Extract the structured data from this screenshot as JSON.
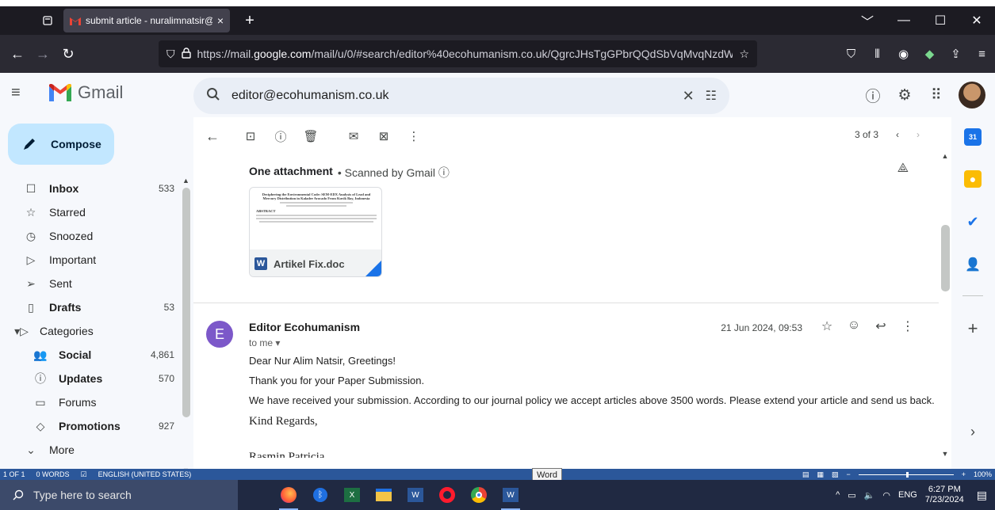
{
  "browser": {
    "tab_title": "submit article - nuralimnatsir@",
    "tab_close": "×",
    "new_tab": "+",
    "url_prefix": "https://mail.",
    "url_domain": "google.com",
    "url_path": "/mail/u/0/#search/editor%40ecohumanism.co.uk/QgrcJHsTgGPbrQQdSbVqMvqNzdWBFrQj",
    "window_controls": [
      "﹀",
      "—",
      "☐",
      "✕"
    ]
  },
  "gmail": {
    "logo_text": "Gmail",
    "search_value": "editor@ecohumanism.co.uk",
    "compose_label": "Compose"
  },
  "sidebar": {
    "items": [
      {
        "icon": "☐",
        "label": "Inbox",
        "count": "533",
        "bold": true,
        "key": "inbox"
      },
      {
        "icon": "☆",
        "label": "Starred",
        "count": "",
        "bold": false,
        "key": "starred"
      },
      {
        "icon": "◷",
        "label": "Snoozed",
        "count": "",
        "bold": false,
        "key": "snoozed"
      },
      {
        "icon": "▷",
        "label": "Important",
        "count": "",
        "bold": false,
        "key": "important"
      },
      {
        "icon": "➢",
        "label": "Sent",
        "count": "",
        "bold": false,
        "key": "sent"
      },
      {
        "icon": "▯",
        "label": "Drafts",
        "count": "53",
        "bold": true,
        "key": "drafts"
      }
    ],
    "categories_label": "Categories",
    "categories": [
      {
        "icon": "👥",
        "label": "Social",
        "count": "4,861",
        "bold": true,
        "key": "social"
      },
      {
        "icon": "ⓘ",
        "label": "Updates",
        "count": "570",
        "bold": true,
        "key": "updates"
      },
      {
        "icon": "▭",
        "label": "Forums",
        "count": "",
        "bold": false,
        "key": "forums"
      },
      {
        "icon": "◇",
        "label": "Promotions",
        "count": "927",
        "bold": true,
        "key": "promotions"
      }
    ],
    "more_label": "More"
  },
  "toolbar": {
    "pager_text": "3 of 3"
  },
  "thread": {
    "attachment_heading": "One attachment",
    "scanned_note": "• Scanned by Gmail ⓘ",
    "attachment_name": "Artikel Fix.doc",
    "doc_title": "Deciphering the Environmental Code: SEM-EDX Analysis of Lead and Mercury Distribution in Kaladee Avocado From Kuvik Bay, Indonesia",
    "doc_abstract_label": "ABSTRACT",
    "sender_initial": "E",
    "sender_name": "Editor Ecohumanism",
    "to_line": "to me ▾",
    "date": "21 Jun 2024, 09:53",
    "body": [
      "Dear Nur Alim Natsir, Greetings!",
      "Thank you for your Paper Submission.",
      "We have received your submission. According to our journal policy we accept articles above 3500 words. Please extend your article and send us back."
    ],
    "closing": "Kind Regards,",
    "signature_partial": "Rasmin Patricia"
  },
  "word_status": {
    "page": "1 OF 1",
    "words": "0 WORDS",
    "language": "ENGLISH (UNITED STATES)",
    "zoom": "100%",
    "tooltip": "Word"
  },
  "taskbar": {
    "search_placeholder": "Type here to search",
    "language": "ENG",
    "time": "6:27 PM",
    "date": "7/23/2024"
  },
  "colors": {
    "compose_bg": "#c2e7ff",
    "sender_avatar": "#7c58c9",
    "word_blue": "#2b579a",
    "taskbar": "#202942"
  }
}
